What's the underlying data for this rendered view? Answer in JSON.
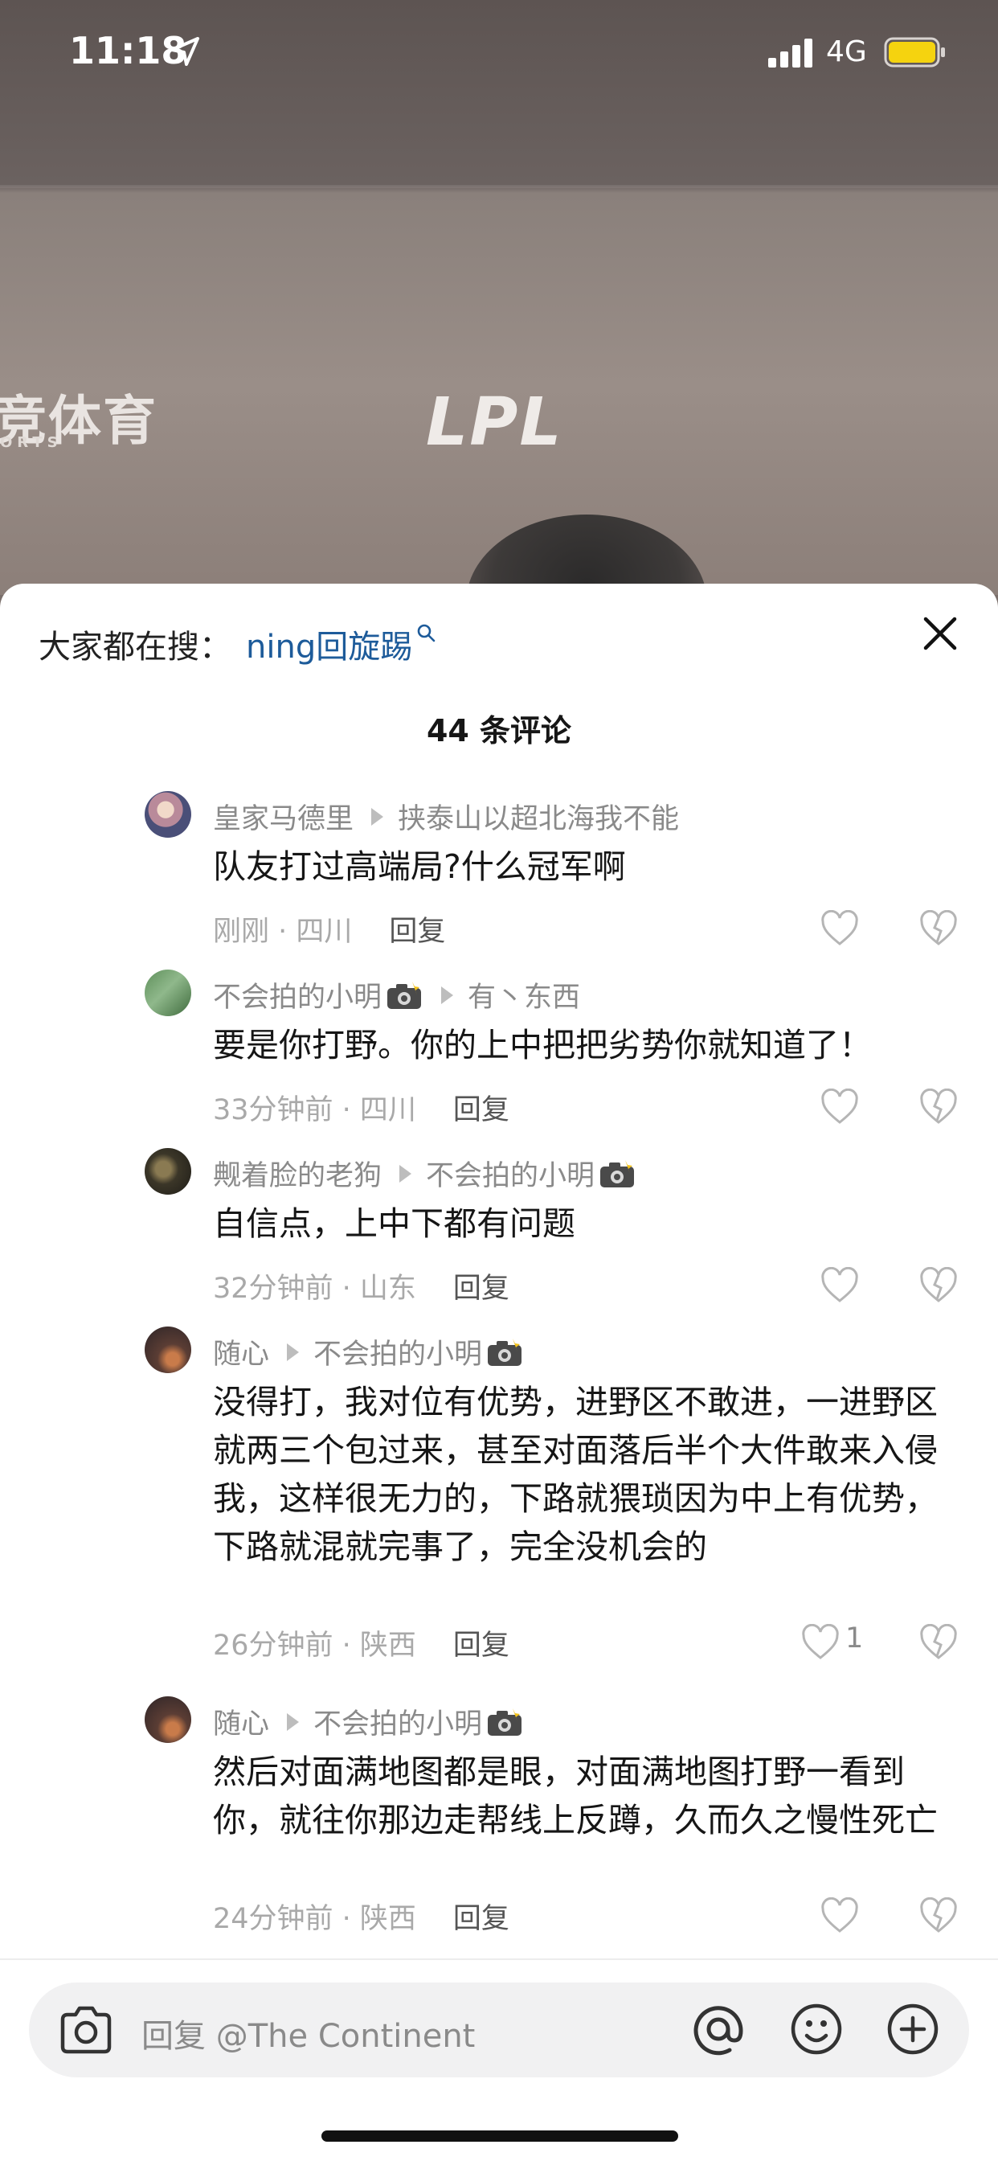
{
  "status_bar": {
    "time": "11:18",
    "network": "4G"
  },
  "video": {
    "left_logo": "竞体育",
    "left_logo_sub": "ORTS",
    "center_logo": "LPL"
  },
  "sheet": {
    "search_hint_label": "大家都在搜：",
    "search_keyword": "ning回旋踢",
    "comment_count": "44 条评论"
  },
  "comments": [
    {
      "user": "皇家马德里",
      "reply_to": "挟泰山以超北海我不能",
      "text": "队友打过高端局?什么冠军啊",
      "time_loc": "刚刚 · 四川",
      "reply_label": "回复",
      "likes": ""
    },
    {
      "user": "不会拍的小明",
      "reply_to": "有丶东西",
      "text": "要是你打野。你的上中把把劣势你就知道了！",
      "time_loc": "33分钟前 · 四川",
      "reply_label": "回复",
      "likes": ""
    },
    {
      "user": "觍着脸的老狗",
      "reply_to": "不会拍的小明",
      "text": "自信点，上中下都有问题",
      "time_loc": "32分钟前 · 山东",
      "reply_label": "回复",
      "likes": ""
    },
    {
      "user": "随心",
      "reply_to": "不会拍的小明",
      "text": "没得打，我对位有优势，进野区不敢进，一进野区就两三个包过来，甚至对面落后半个大件敢来入侵我，这样很无力的，下路就猥琐因为中上有优势，下路就混就完事了，完全没机会的",
      "time_loc": "26分钟前 · 陕西",
      "reply_label": "回复",
      "likes": "1"
    },
    {
      "user": "随心",
      "reply_to": "不会拍的小明",
      "text": "然后对面满地图都是眼，对面满地图打野一看到你，就往你那边走帮线上反蹲，久而久之慢性死亡",
      "time_loc": "24分钟前 · 陕西",
      "reply_label": "回复",
      "likes": ""
    }
  ],
  "input_bar": {
    "placeholder": "回复 @The Continent"
  },
  "icons": {
    "location": "location-arrow-icon",
    "signal": "cellular-signal-icon",
    "battery": "battery-icon",
    "search": "search-icon",
    "close": "close-icon",
    "like": "heart-icon",
    "dislike": "broken-heart-icon",
    "camera": "camera-icon",
    "at": "at-icon",
    "emoji": "emoji-icon",
    "plus": "plus-icon"
  },
  "colors": {
    "keyword_link": "#1d5b9a",
    "battery_fill": "#f5d30f",
    "sheet_bg": "#ffffff",
    "input_bg": "#f1f1f2"
  }
}
